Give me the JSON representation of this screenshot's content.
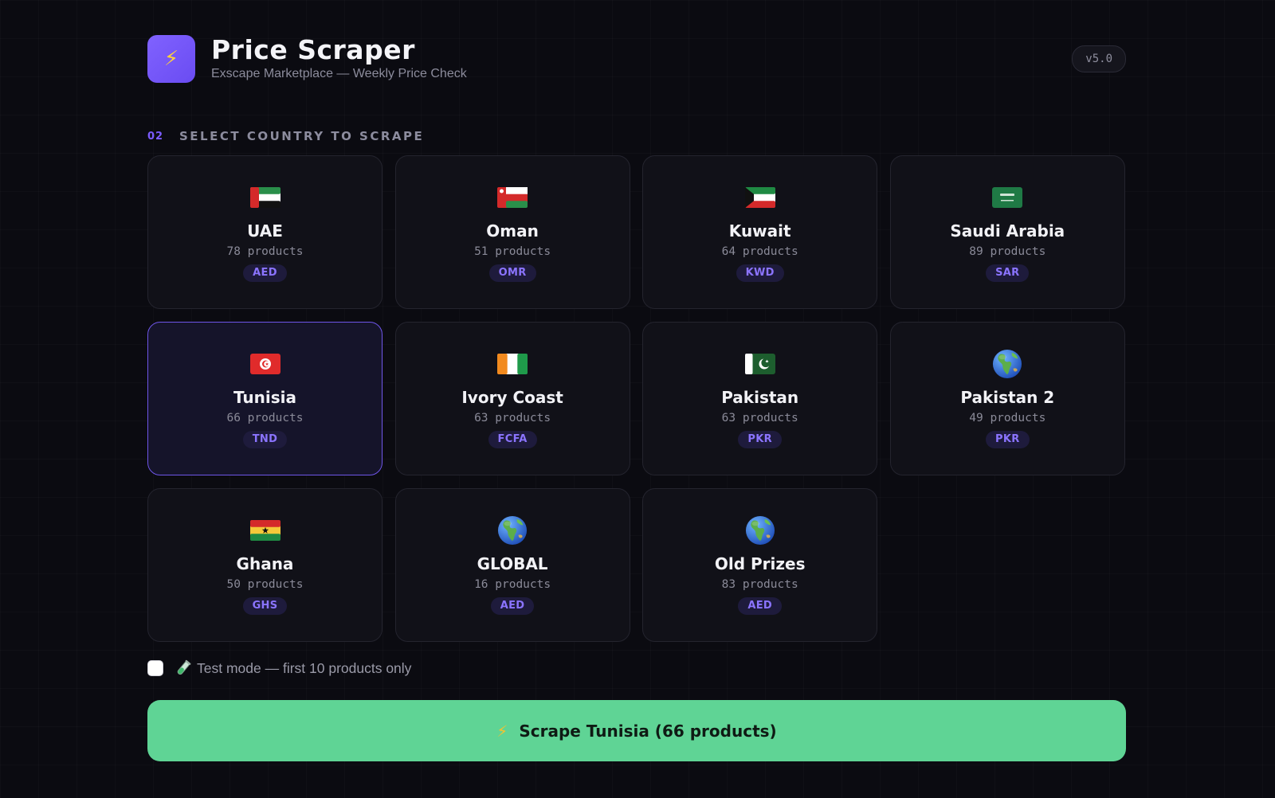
{
  "header": {
    "logo_icon": "lightning-bolt-icon",
    "title": "Price Scraper",
    "subtitle": "Exscape Marketplace — Weekly Price Check",
    "version": "v5.0"
  },
  "section": {
    "number": "02",
    "label": "SELECT COUNTRY TO SCRAPE"
  },
  "countries": [
    {
      "name": "UAE",
      "products": "78 products",
      "currency": "AED",
      "flag": "uae-flag-icon",
      "selected": false
    },
    {
      "name": "Oman",
      "products": "51 products",
      "currency": "OMR",
      "flag": "oman-flag-icon",
      "selected": false
    },
    {
      "name": "Kuwait",
      "products": "64 products",
      "currency": "KWD",
      "flag": "kuwait-flag-icon",
      "selected": false
    },
    {
      "name": "Saudi Arabia",
      "products": "89 products",
      "currency": "SAR",
      "flag": "saudi-arabia-flag-icon",
      "selected": false
    },
    {
      "name": "Tunisia",
      "products": "66 products",
      "currency": "TND",
      "flag": "tunisia-flag-icon",
      "selected": true
    },
    {
      "name": "Ivory Coast",
      "products": "63 products",
      "currency": "FCFA",
      "flag": "ivory-coast-flag-icon",
      "selected": false
    },
    {
      "name": "Pakistan",
      "products": "63 products",
      "currency": "PKR",
      "flag": "pakistan-flag-icon",
      "selected": false
    },
    {
      "name": "Pakistan 2",
      "products": "49 products",
      "currency": "PKR",
      "flag": "globe-icon",
      "selected": false
    },
    {
      "name": "Ghana",
      "products": "50 products",
      "currency": "GHS",
      "flag": "ghana-flag-icon",
      "selected": false
    },
    {
      "name": "GLOBAL",
      "products": "16 products",
      "currency": "AED",
      "flag": "globe-icon",
      "selected": false
    },
    {
      "name": "Old Prizes",
      "products": "83 products",
      "currency": "AED",
      "flag": "globe-icon",
      "selected": false
    }
  ],
  "test_mode": {
    "checked": false,
    "icon": "test-tube-icon",
    "label": "Test mode — first 10 products only"
  },
  "action": {
    "icon": "lightning-bolt-icon",
    "label": "Scrape Tunisia (66 products)"
  },
  "colors": {
    "accent": "#7c5cff",
    "action_green": "#5fd495",
    "background": "#0b0b11"
  }
}
